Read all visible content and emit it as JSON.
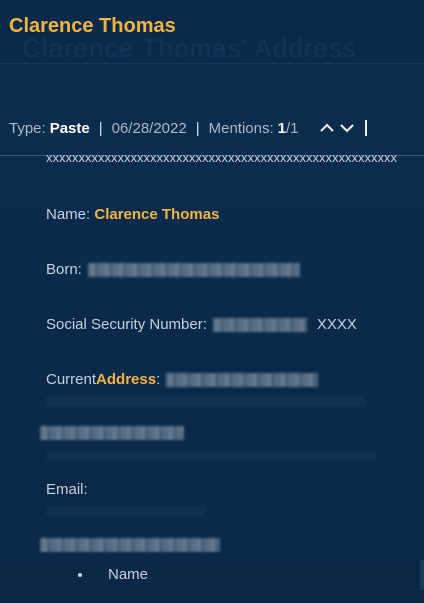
{
  "header": {
    "title": "Clarence Thomas",
    "background_text": "Clarence Thomas' Address"
  },
  "meta": {
    "type_label": "Type:",
    "type_value": "Paste",
    "separator": "|",
    "date": "06/28/2022",
    "mentions_label": "Mentions:",
    "mentions_current": "1",
    "mentions_total": "/1"
  },
  "record": {
    "x_line": "xxxxxxxxxxxxxxxxxxxxxxxxxxxxxxxxxxxxxxxxxxxxxxxxxxxxxx",
    "name_label": "Name:",
    "name_value": "Clarence Thomas",
    "born_label": "Born:",
    "ssn_label": "Social Security Number:",
    "ssn_suffix": "XXXX",
    "address_prefix": "Current ",
    "address_highlight": "Address",
    "address_suffix": ":",
    "email_label": "Email:",
    "bullet_item": "Name"
  },
  "colors": {
    "background": "#0b2a4a",
    "accent": "#f2b443",
    "text": "#c5d1de"
  },
  "icons": {
    "prev": "chevron-up-icon",
    "next": "chevron-down-icon"
  }
}
